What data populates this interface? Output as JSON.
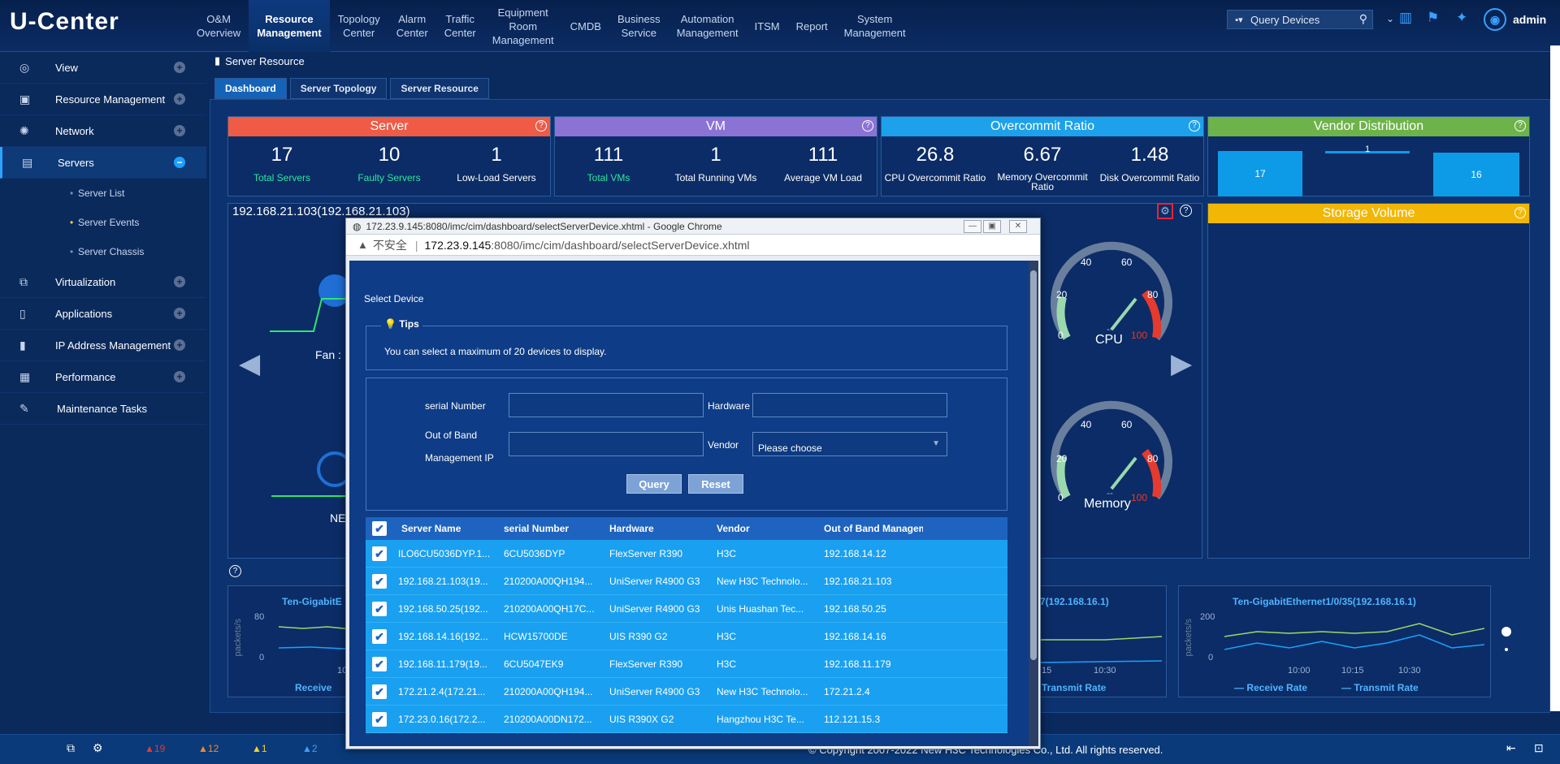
{
  "app": {
    "logo": "U-Center"
  },
  "nav": [
    {
      "label": "O&M\nOverview"
    },
    {
      "label": "Resource\nManagement"
    },
    {
      "label": "Topology\nCenter"
    },
    {
      "label": "Alarm\nCenter"
    },
    {
      "label": "Traffic\nCenter"
    },
    {
      "label": "Equipment\nRoom\nManagement"
    },
    {
      "label": "CMDB"
    },
    {
      "label": "Business\nService"
    },
    {
      "label": "Automation\nManagement"
    },
    {
      "label": "ITSM"
    },
    {
      "label": "Report"
    },
    {
      "label": "System\nManagement"
    }
  ],
  "header": {
    "search_label": "Query Devices",
    "user": "admin"
  },
  "sidebar": {
    "items": [
      {
        "label": "View"
      },
      {
        "label": "Resource Management"
      },
      {
        "label": "Network"
      },
      {
        "label": "Servers"
      },
      {
        "label": "Virtualization"
      },
      {
        "label": "Applications"
      },
      {
        "label": "IP Address Management"
      },
      {
        "label": "Performance"
      },
      {
        "label": "Maintenance Tasks"
      }
    ],
    "sub": [
      {
        "label": "Server List"
      },
      {
        "label": "Server Events"
      },
      {
        "label": "Server Chassis"
      }
    ]
  },
  "breadcrumb": "Server Resource",
  "tabs": [
    {
      "label": "Dashboard"
    },
    {
      "label": "Server Topology"
    },
    {
      "label": "Server Resource"
    }
  ],
  "cards": {
    "server": {
      "title": "Server",
      "stats": [
        {
          "value": "17",
          "label": "Total Servers"
        },
        {
          "value": "10",
          "label": "Faulty Servers"
        },
        {
          "value": "1",
          "label": "Low-Load Servers"
        }
      ]
    },
    "vm": {
      "title": "VM",
      "stats": [
        {
          "value": "111",
          "label": "Total VMs"
        },
        {
          "value": "1",
          "label": "Total Running VMs"
        },
        {
          "value": "111",
          "label": "Average VM Load"
        }
      ]
    },
    "overcommit": {
      "title": "Overcommit Ratio",
      "stats": [
        {
          "value": "26.8",
          "label": "CPU Overcommit Ratio"
        },
        {
          "value": "6.67",
          "label": "Memory Overcommit Ratio"
        },
        {
          "value": "1.48",
          "label": "Disk Overcommit Ratio"
        }
      ]
    },
    "vendor": {
      "title": "Vendor Distribution",
      "bars": [
        "17",
        "1",
        "16"
      ]
    },
    "storage": {
      "title": "Storage Volume"
    }
  },
  "device": {
    "title": "192.168.21.103(192.168.21.103)",
    "fan_label": "Fan :",
    "ne_label": "NE"
  },
  "gauges": {
    "cpu": {
      "label": "CPU",
      "value": "--",
      "ticks": [
        "0",
        "20",
        "40",
        "60",
        "80",
        "100"
      ]
    },
    "memory": {
      "label": "Memory",
      "value": "--",
      "ticks": [
        "0",
        "20",
        "40",
        "60",
        "80",
        "100"
      ]
    }
  },
  "bottom": {
    "left_title": "Ten-GigabitE",
    "left_legend": "Receive",
    "mid_title": "7(192.168.16.1)",
    "mid_legend": "Transmit Rate",
    "mid_ticks": [
      "15",
      "10:30"
    ],
    "right_title": "Ten-GigabitEthernet1/0/35(192.168.16.1)",
    "right_legend_rx": "Receive Rate",
    "right_legend_tx": "Transmit Rate",
    "right_ticks": [
      "10:00",
      "10:15",
      "10:30"
    ],
    "yaxis": "packets/s",
    "y_left": [
      "80",
      "0"
    ],
    "y_right": [
      "200",
      "0"
    ],
    "x_left": "10"
  },
  "status": {
    "alarms": [
      "19",
      "12",
      "1",
      "2"
    ],
    "copyright": "© Copyright 2007-2022 New H3C Technologies Co., Ltd. All rights reserved."
  },
  "popup": {
    "window_title": "172.23.9.145:8080/imc/cim/dashboard/selectServerDevice.xhtml - Google Chrome",
    "insecure": "不安全",
    "url_host": "172.23.9.145",
    "url_path": ":8080/imc/cim/dashboard/selectServerDevice.xhtml",
    "heading": "Select Device",
    "tips_label": "Tips",
    "tips_text": "You can select a maximum of 20 devices to display.",
    "fields": {
      "serial": "serial Number",
      "hardware": "Hardware",
      "oob1": "Out of Band",
      "oob2": "Management IP",
      "vendor": "Vendor",
      "vendor_value": "Please choose"
    },
    "query": "Query",
    "reset": "Reset",
    "columns": [
      "Server Name",
      "serial Number",
      "Hardware",
      "Vendor",
      "Out of Band Managem"
    ],
    "rows": [
      [
        "ILO6CU5036DYP.1...",
        "6CU5036DYP",
        "FlexServer R390",
        "H3C",
        "192.168.14.12"
      ],
      [
        "192.168.21.103(19...",
        "210200A00QH194...",
        "UniServer R4900 G3",
        "New H3C Technolo...",
        "192.168.21.103"
      ],
      [
        "192.168.50.25(192...",
        "210200A00QH17C...",
        "UniServer R4900 G3",
        "Unis Huashan Tec...",
        "192.168.50.25"
      ],
      [
        "192.168.14.16(192...",
        "HCW15700DE",
        "UIS R390 G2",
        "H3C",
        "192.168.14.16"
      ],
      [
        "192.168.11.179(19...",
        "6CU5047EK9",
        "FlexServer R390",
        "H3C",
        "192.168.11.179"
      ],
      [
        "172.21.2.4(172.21...",
        "210200A00QH194...",
        "UniServer R4900 G3",
        "New H3C Technolo...",
        "172.21.2.4"
      ],
      [
        "172.23.0.16(172.2...",
        "210200A00DN172...",
        "UIS R390X G2",
        "Hangzhou H3C Te...",
        "112.121.15.3"
      ]
    ]
  }
}
